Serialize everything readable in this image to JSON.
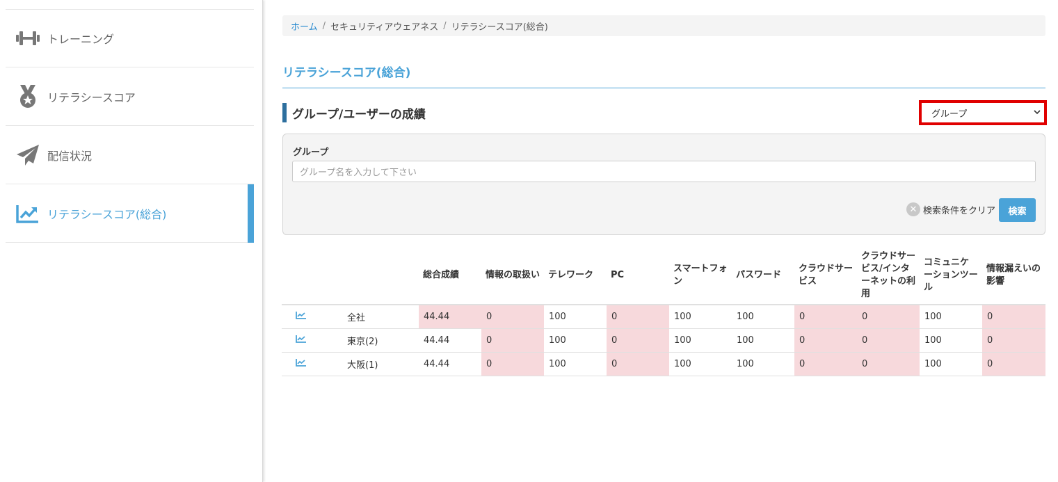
{
  "sidebar": {
    "items": [
      {
        "label": "トレーニング",
        "icon": "dumbbell-icon"
      },
      {
        "label": "リテラシースコア",
        "icon": "medal-icon"
      },
      {
        "label": "配信状況",
        "icon": "paper-plane-icon"
      },
      {
        "label": "リテラシースコア(総合)",
        "icon": "chart-line-icon",
        "active": true
      }
    ]
  },
  "breadcrumb": {
    "home": "ホーム",
    "sep": "/",
    "level1": "セキュリティアウェアネス",
    "level2": "リテラシースコア(総合)"
  },
  "page": {
    "title": "リテラシースコア(総合)",
    "section_title": "グループ/ユーザーの成績"
  },
  "view_select": {
    "selected": "グループ"
  },
  "search": {
    "label": "グループ",
    "placeholder": "グループ名を入力して下さい",
    "clear_label": "検索条件をクリア",
    "search_label": "検索"
  },
  "table": {
    "headers": [
      "総合成績",
      "情報の取扱い",
      "テレワーク",
      "PC",
      "スマートフォン",
      "パスワード",
      "クラウドサービス",
      "クラウドサービス/インターネットの利用",
      "コミュニケーションツール",
      "情報漏えいの影響"
    ],
    "rows": [
      {
        "name": "全社",
        "values": [
          "44.44",
          "0",
          "100",
          "0",
          "100",
          "100",
          "0",
          "0",
          "100",
          "0"
        ]
      },
      {
        "name": "東京(2)",
        "values": [
          "44.44",
          "0",
          "100",
          "0",
          "100",
          "100",
          "0",
          "0",
          "100",
          "0"
        ]
      },
      {
        "name": "大阪(1)",
        "values": [
          "44.44",
          "0",
          "100",
          "0",
          "100",
          "100",
          "0",
          "0",
          "100",
          "0"
        ]
      }
    ]
  },
  "colors": {
    "accent": "#4aa3d8",
    "highlight_red": "#e00000",
    "low_score_bg": "#f7d9dc",
    "section_bar": "#2d6f9e"
  }
}
